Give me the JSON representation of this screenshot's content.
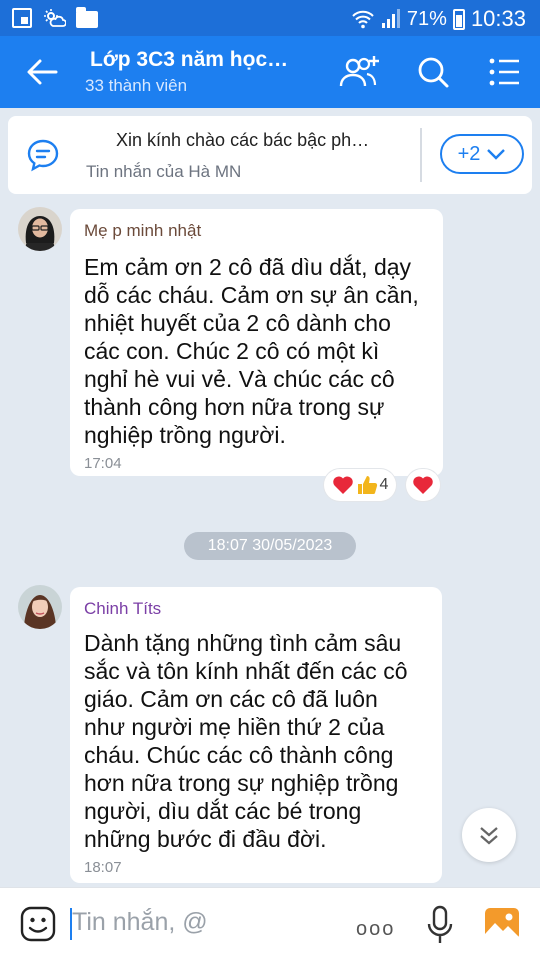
{
  "status_bar": {
    "battery": "71%",
    "time": "10:33"
  },
  "header": {
    "title": "Lớp 3C3 năm học…",
    "subtitle": "33 thành viên"
  },
  "pinned": {
    "text": "Xin kính chào các bác bậc ph…",
    "from": "Tin nhắn của Hà MN",
    "more_label": "+2"
  },
  "messages": [
    {
      "sender": "Mẹ p minh nhật",
      "sender_color": "#6b4a3a",
      "lines": [
        "Em cảm ơn  2 cô đã dìu dắt, dạy",
        "dỗ các cháu. Cảm ơn sự ân cần,",
        "nhiệt huyết của 2 cô dành cho",
        "các con. Chúc 2 cô có một kì",
        "nghỉ hè vui vẻ. Và chúc các cô",
        "thành công hơn nữa trong sự",
        "nghiệp trồng người."
      ],
      "time": "17:04",
      "reaction_count": "4"
    },
    {
      "sender": "Chinh Títs",
      "sender_color": "#7b3fa6",
      "lines": [
        "Dành tặng những tình cảm sâu",
        "sắc và tôn kính nhất đến các cô",
        "giáo. Cảm ơn các cô đã luôn",
        "như người mẹ hiền thứ 2 của",
        "cháu. Chúc các cô thành công",
        "hơn nữa trong sự nghiệp trồng",
        "người, dìu dắt các bé trong",
        "những bước đi đầu đời."
      ],
      "time": "18:07"
    }
  ],
  "date_separator": "18:07 30/05/2023",
  "input": {
    "placeholder": "Tin nhắn, @",
    "more_label": "ooo"
  }
}
